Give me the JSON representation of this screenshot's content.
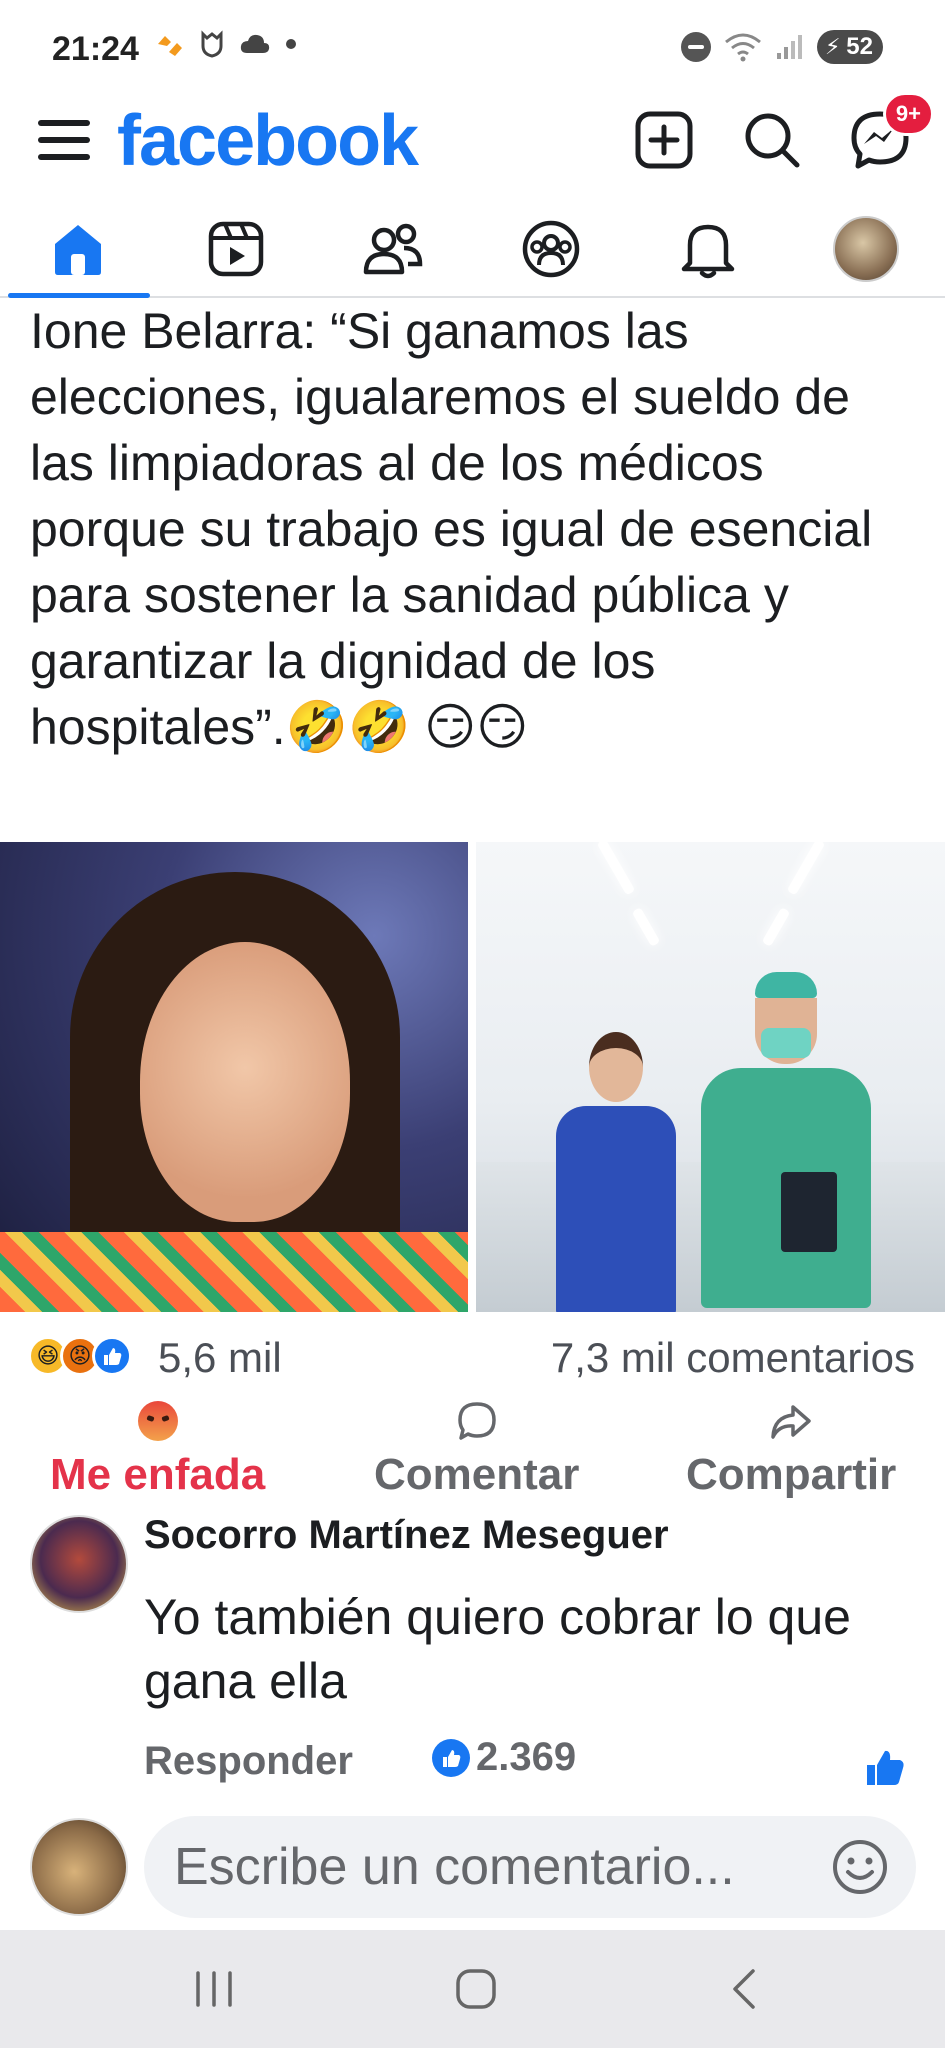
{
  "status_bar": {
    "time": "21:24",
    "battery": "52",
    "left_icons": [
      "notification-icon",
      "shield-icon",
      "cloud-icon",
      "dot-icon"
    ],
    "right_icons": [
      "do-not-disturb-icon",
      "wifi-icon",
      "signal-icon",
      "battery-icon"
    ]
  },
  "app_bar": {
    "logo": "facebook",
    "messenger_badge": "9+",
    "brand_color": "#1877f2"
  },
  "tabs": [
    {
      "name": "home",
      "icon": "home-icon",
      "active": true
    },
    {
      "name": "video",
      "icon": "video-icon",
      "active": false
    },
    {
      "name": "friends",
      "icon": "friends-icon",
      "active": false
    },
    {
      "name": "groups",
      "icon": "groups-icon",
      "active": false
    },
    {
      "name": "notifications",
      "icon": "bell-icon",
      "active": false
    },
    {
      "name": "profile",
      "icon": "profile-avatar",
      "active": false
    }
  ],
  "post": {
    "text": "Ione Belarra: “Si ganamos las elecciones, igualaremos el sueldo de las limpiadoras al de los médicos porque su trabajo es igual de esencial para sostener la sanidad pública y garantizar la dignidad de los hospitales”.🤣🤣 😏😏",
    "reactions_count": "5,6 mil",
    "comments_count": "7,3 mil comentarios",
    "reaction_types": [
      "haha",
      "angry",
      "like"
    ]
  },
  "actions": {
    "react_label": "Me enfada",
    "react_color": "#e4334a",
    "comment_label": "Comentar",
    "share_label": "Compartir"
  },
  "comment": {
    "author": "Socorro Martínez Meseguer",
    "text": "Yo también quiero cobrar lo que gana ella",
    "reply_label": "Responder",
    "likes": "2.369"
  },
  "composer": {
    "placeholder": "Escribe un comentario..."
  }
}
